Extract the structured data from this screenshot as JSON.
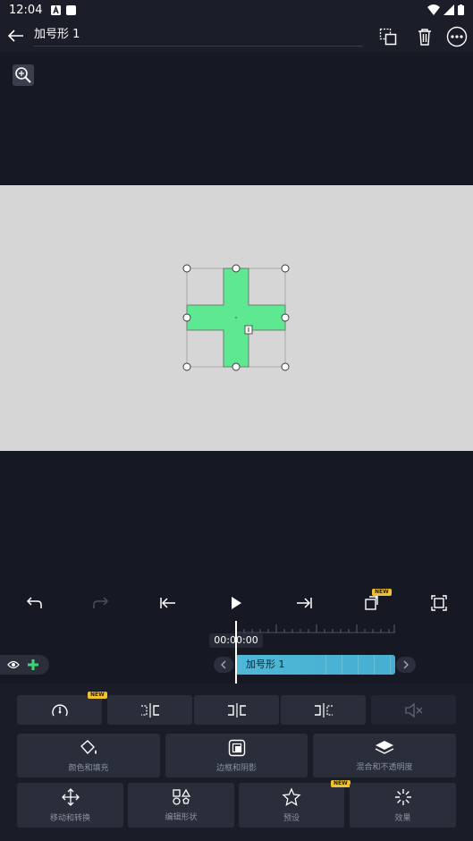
{
  "status_bar": {
    "time": "12:04"
  },
  "header": {
    "title": "加号形 1"
  },
  "timeline": {
    "timecode": "00:00:00",
    "clip_label": "加号形 1"
  },
  "badges": {
    "new": "NEW"
  },
  "tools": {
    "row1": [
      "speed",
      "split-left",
      "split-center",
      "split-right",
      "mute"
    ],
    "row2": [
      {
        "label": "颜色和填充",
        "icon": "paint-bucket-icon"
      },
      {
        "label": "边框和阴影",
        "icon": "border-shadow-icon"
      },
      {
        "label": "混合和不透明度",
        "icon": "layers-icon"
      }
    ],
    "row3": [
      {
        "label": "移动和转换",
        "icon": "move-icon"
      },
      {
        "label": "编辑形状",
        "icon": "shapes-icon"
      },
      {
        "label": "预设",
        "icon": "star-icon"
      },
      {
        "label": "效果",
        "icon": "sparkle-icon"
      }
    ]
  },
  "colors": {
    "shape_fill": "#5ee892",
    "clip": "#4fb7d7",
    "badge": "#f2c12e",
    "canvas": "#d6d6d6"
  }
}
